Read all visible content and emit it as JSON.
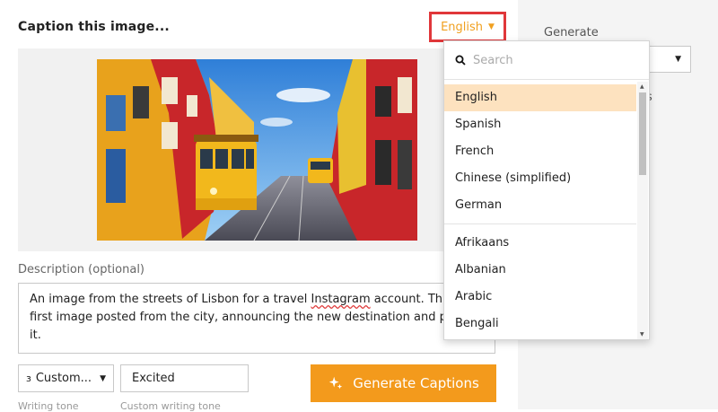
{
  "header": {
    "title": "Caption this image..."
  },
  "language_button": {
    "label": "English"
  },
  "description": {
    "label": "Description (optional)",
    "line1_before": "An image from the streets of Lisbon for a travel ",
    "line1_misspelled": "Instagram",
    "line1_after": " account. This",
    "line2": "first image posted from the city, announcing the new destination and pra",
    "line3": "it."
  },
  "tone": {
    "select_value": "Custom...",
    "select_label": "Writing tone",
    "custom_value": "Excited",
    "custom_label": "Custom writing tone"
  },
  "generate_button": {
    "label": "Generate Captions"
  },
  "right_panel": {
    "label": "Generate",
    "fragment": "s"
  },
  "dropdown": {
    "search_placeholder": "Search",
    "top_items": [
      "English",
      "Spanish",
      "French",
      "Chinese (simplified)",
      "German"
    ],
    "other_items": [
      "Afrikaans",
      "Albanian",
      "Arabic",
      "Bengali"
    ],
    "selected": "English"
  },
  "colors": {
    "accent": "#f39a1c",
    "highlight": "#fde2bf",
    "focus_border": "#e0373a"
  }
}
